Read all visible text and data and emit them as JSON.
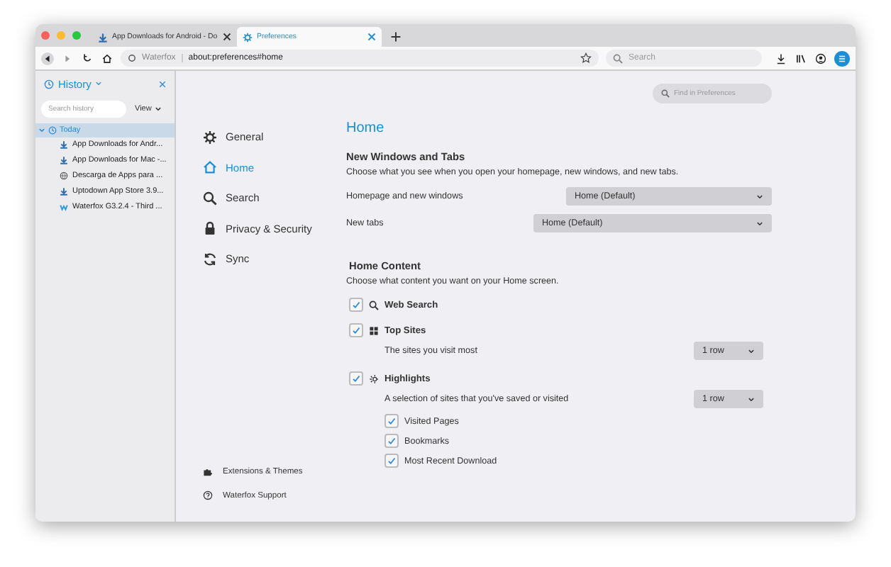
{
  "tabs": [
    {
      "label": "App Downloads for Android - Do",
      "kind": "download",
      "selected": false
    },
    {
      "label": "Preferences",
      "kind": "gear",
      "selected": true
    }
  ],
  "toolbar": {
    "identity": "Waterfox",
    "url": "about:preferences#home",
    "search_placeholder": "Search"
  },
  "sidebar": {
    "title": "History",
    "search_placeholder": "Search history",
    "view_button": "View",
    "groups": [
      {
        "label": "Today",
        "expanded": true,
        "selected": true,
        "children": [
          {
            "label": "App Downloads for Andr...",
            "kind": "download"
          },
          {
            "label": "App Downloads for Mac -...",
            "kind": "download"
          },
          {
            "label": "Descarga de Apps para ...",
            "kind": "globe"
          },
          {
            "label": "Uptodown App Store 3.9...",
            "kind": "download"
          },
          {
            "label": "Waterfox G3.2.4 - Third ...",
            "kind": "waterfox"
          }
        ]
      }
    ]
  },
  "preferences": {
    "find_placeholder": "Find in Preferences",
    "nav": [
      {
        "label": "General",
        "kind": "gear",
        "selected": false
      },
      {
        "label": "Home",
        "kind": "home",
        "selected": true
      },
      {
        "label": "Search",
        "kind": "search",
        "selected": false
      },
      {
        "label": "Privacy & Security",
        "kind": "lock",
        "selected": false
      },
      {
        "label": "Sync",
        "kind": "sync",
        "selected": false
      }
    ],
    "footer_links": [
      {
        "label": "Extensions & Themes",
        "kind": "puzzle"
      },
      {
        "label": "Waterfox Support",
        "kind": "help"
      }
    ],
    "heading": "Home",
    "new_windows": {
      "title": "New Windows and Tabs",
      "description": "Choose what you see when you open your homepage, new windows, and new tabs.",
      "settings": [
        {
          "label": "Homepage and new windows",
          "value": "Home (Default)"
        },
        {
          "label": "New tabs",
          "value": "Home (Default)"
        }
      ]
    },
    "home_content": {
      "title": "Home Content",
      "description": "Choose what content you want on your Home screen.",
      "items": [
        {
          "label": "Web Search",
          "kind": "search",
          "checked": true
        },
        {
          "label": "Top Sites",
          "kind": "grid",
          "checked": true,
          "description": "The sites you visit most",
          "select": "1 row"
        },
        {
          "label": "Highlights",
          "kind": "sparkle",
          "checked": true,
          "description": "A selection of sites that you've saved or visited",
          "select": "1 row",
          "children": [
            {
              "label": "Visited Pages",
              "checked": true
            },
            {
              "label": "Bookmarks",
              "checked": true
            },
            {
              "label": "Most Recent Download",
              "checked": true
            }
          ]
        }
      ]
    }
  }
}
